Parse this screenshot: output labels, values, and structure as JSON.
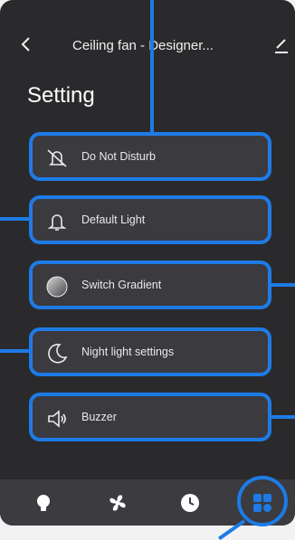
{
  "header": {
    "title": "Ceiling fan - Designer...",
    "back_icon": "chevron-left-icon",
    "edit_icon": "pencil-icon"
  },
  "page": {
    "heading": "Setting"
  },
  "settings": [
    {
      "label": "Do Not Disturb",
      "icon": "bell-slash-icon"
    },
    {
      "label": "Default Light",
      "icon": "bell-icon"
    },
    {
      "label": "Switch Gradient",
      "icon": "gradient-circle-icon"
    },
    {
      "label": "Night light settings",
      "icon": "moon-icon"
    },
    {
      "label": "Buzzer",
      "icon": "speaker-icon"
    }
  ],
  "tabs": [
    {
      "name": "light",
      "icon": "bulb-icon"
    },
    {
      "name": "fan",
      "icon": "fan-icon"
    },
    {
      "name": "schedule",
      "icon": "clock-icon"
    },
    {
      "name": "settings",
      "icon": "grid-icon",
      "active": true
    }
  ],
  "colors": {
    "highlight": "#1e7be6",
    "active_tab": "#1e7be6",
    "background": "#2a2a2d"
  }
}
